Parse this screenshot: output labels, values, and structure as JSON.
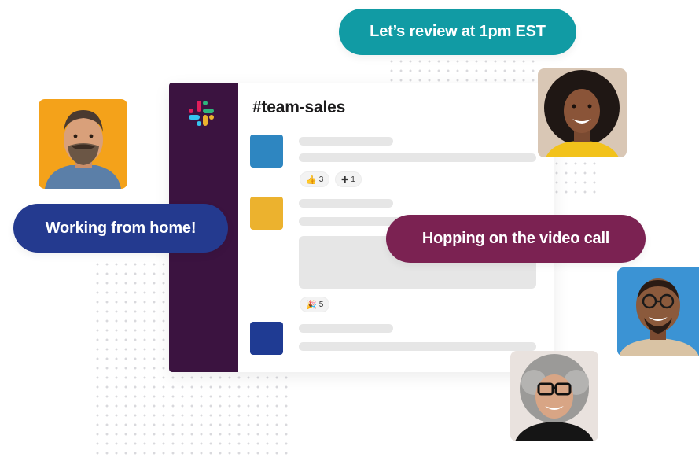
{
  "channel": {
    "name": "#team-sales"
  },
  "messages": [
    {
      "avatar_color": "#2e86c1",
      "reactions": [
        {
          "emoji": "👍",
          "count": "3"
        },
        {
          "emoji": "✚",
          "count": "1"
        }
      ]
    },
    {
      "avatar_color": "#ecb22e",
      "reactions": [
        {
          "emoji": "🎉",
          "count": "5"
        }
      ]
    },
    {
      "avatar_color": "#1f3b93",
      "reactions": []
    }
  ],
  "bubbles": {
    "review": "Let’s review at 1pm EST",
    "home": "Working from home!",
    "video": "Hopping on the video call"
  },
  "colors": {
    "sidebar": "#3b1340",
    "teal": "#119ba4",
    "navy": "#243a8f",
    "plum": "#7b2252"
  },
  "icons": {
    "logo": "slack-logo-icon"
  }
}
